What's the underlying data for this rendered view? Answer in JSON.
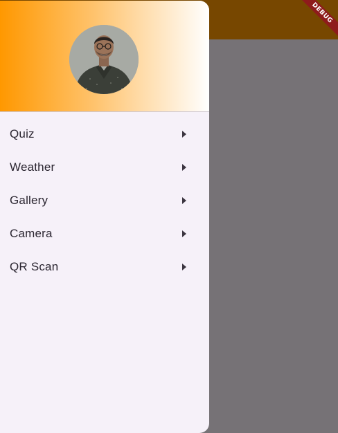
{
  "app": {
    "debug_label": "DEBUG"
  },
  "drawer": {
    "header": {
      "avatar_alt": "profile-photo"
    },
    "items": [
      {
        "label": "Quiz",
        "icon": "arrow-right-icon"
      },
      {
        "label": "Weather",
        "icon": "arrow-right-icon"
      },
      {
        "label": "Gallery",
        "icon": "arrow-right-icon"
      },
      {
        "label": "Camera",
        "icon": "arrow-right-icon"
      },
      {
        "label": "QR Scan",
        "icon": "arrow-right-icon"
      }
    ]
  },
  "colors": {
    "app_bar": "#774700",
    "scrim": "#767276",
    "drawer_bg": "#f6f1f9",
    "header_gradient_start": "#ff9800",
    "header_gradient_end": "#ffffff"
  }
}
